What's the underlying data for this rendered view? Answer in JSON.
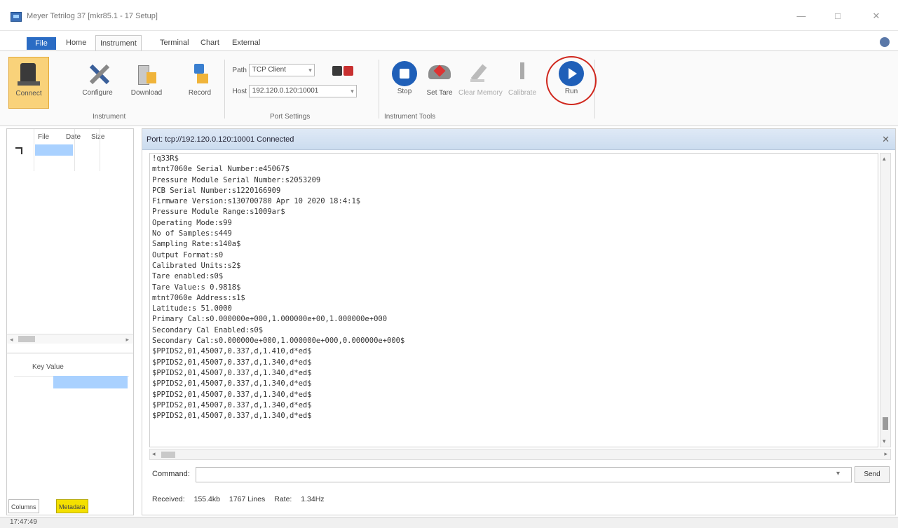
{
  "window": {
    "title": "Meyer Tetrilog 37 [mkr85.1 - 17 Setup]",
    "controls": [
      "—",
      "□",
      "✕"
    ]
  },
  "ribbon_tabs": [
    {
      "label": "File",
      "active": false
    },
    {
      "label": "Home",
      "active": false
    },
    {
      "label": "Instrument",
      "active": true
    },
    {
      "label": "Terminal",
      "active": false
    },
    {
      "label": "Chart",
      "active": false
    },
    {
      "label": "External",
      "active": false
    }
  ],
  "ribbon": {
    "instrument_group": {
      "label": "Instrument",
      "buttons": [
        "Connect",
        "Configure",
        "Download",
        "Record"
      ]
    },
    "port_settings": {
      "label": "Port Settings",
      "path_label": "Path",
      "path_value": "TCP Client",
      "host_label": "Host",
      "host_value": "192.120.0.120:10001"
    },
    "instrument_tools": {
      "label": "Instrument Tools",
      "buttons": [
        {
          "label": "Stop",
          "enabled": true
        },
        {
          "label": "Set Tare",
          "enabled": true
        },
        {
          "label": "Clear Memory",
          "enabled": false
        },
        {
          "label": "Calibrate",
          "enabled": false
        },
        {
          "label": "Run",
          "enabled": true
        }
      ]
    }
  },
  "left_panel": {
    "file_columns": [
      "File",
      "Date",
      "Size"
    ],
    "property_columns": [
      "Key",
      "Value"
    ],
    "tabs": [
      {
        "label": "Columns",
        "active": false
      },
      {
        "label": "Metadata",
        "active": true
      }
    ]
  },
  "terminal": {
    "header": "Port: tcp://192.120.0.120:10001 Connected",
    "lines": [
      "!q33R$",
      "mtnt7060e Serial Number:e45067$",
      "Pressure Module Serial Number:s2053209",
      "PCB Serial Number:s1220166909",
      "Firmware Version:s130700780 Apr 10 2020 18:4:1$",
      "Pressure Module Range:s1009ar$",
      "Operating Mode:s99",
      "No of Samples:s449",
      "Sampling Rate:s140a$",
      "Output Format:s0",
      "Calibrated Units:s2$",
      "Tare enabled:s0$",
      "Tare Value:s 0.9818$",
      "mtnt7060e Address:s1$",
      "Latitude:s 51.0000",
      "Primary Cal:s0.000000e+000,1.000000e+00,1.000000e+000",
      "Secondary Cal Enabled:s0$",
      "Secondary Cal:s0.000000e+000,1.000000e+000,0.000000e+000$",
      "$PPIDS2,01,45007,0.337,d,1.410,d*ed$",
      "$PPIDS2,01,45007,0.337,d,1.340,d*ed$",
      "$PPIDS2,01,45007,0.337,d,1.340,d*ed$",
      "$PPIDS2,01,45007,0.337,d,1.340,d*ed$",
      "$PPIDS2,01,45007,0.337,d,1.340,d*ed$",
      "$PPIDS2,01,45007,0.337,d,1.340,d*ed$",
      "$PPIDS2,01,45007,0.337,d,1.340,d*ed$"
    ],
    "command_label": "Command:",
    "command_value": "",
    "send_label": "Send",
    "status": {
      "received_label": "Received:",
      "received_value": "155.4kb",
      "lines_value": "1767 Lines",
      "rate_label": "Rate:",
      "rate_value": "1.34Hz"
    }
  },
  "statusbar": {
    "time": "17:47:49"
  },
  "colors": {
    "file_tab": "#2b6cc4",
    "connect_active": "#f9d27a",
    "selection": "#a9d1ff",
    "run_highlight": "#d0281e",
    "metadata_tab": "#f4e000"
  }
}
